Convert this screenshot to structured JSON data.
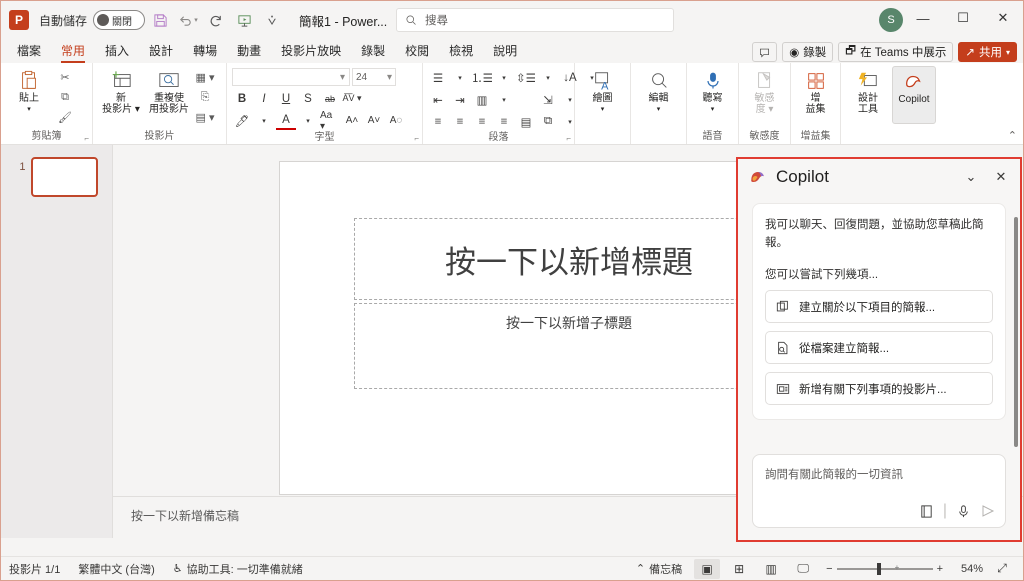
{
  "titlebar": {
    "app_logo": "powerpoint-logo",
    "autosave_label": "自動儲存",
    "autosave_state": "關閉",
    "document_title": "簡報1 - Power...",
    "search_placeholder": "搜尋",
    "avatar_initial": "S",
    "quick_access": [
      "save-icon",
      "undo-icon",
      "redo-icon",
      "start-slideshow-icon",
      "customize-qat-icon"
    ],
    "window_buttons": [
      "minimize",
      "maximize",
      "close"
    ]
  },
  "ribbon_tabs": {
    "items": [
      "檔案",
      "常用",
      "插入",
      "設計",
      "轉場",
      "動畫",
      "投影片放映",
      "錄製",
      "校閱",
      "檢視",
      "說明"
    ],
    "active": "常用",
    "right_actions": {
      "comments": "",
      "record": "錄製",
      "present_in_teams": "在 Teams 中展示",
      "share": "共用"
    }
  },
  "ribbon": {
    "groups": [
      {
        "label": "剪貼簿",
        "big": [
          {
            "label": "貼上",
            "icon": "paste-icon"
          }
        ],
        "small": [
          {
            "label": "",
            "icon": "cut-icon"
          },
          {
            "label": "",
            "icon": "copy-icon"
          },
          {
            "label": "",
            "icon": "format-painter-icon"
          }
        ]
      },
      {
        "label": "投影片",
        "big": [
          {
            "label": "新\n投影片",
            "icon": "new-slide-icon"
          },
          {
            "label": "重複使\n用投影片",
            "icon": "reuse-slides-icon"
          }
        ],
        "small": [
          {
            "label": "",
            "icon": "layout-icon"
          },
          {
            "label": "",
            "icon": "reset-icon"
          },
          {
            "label": "",
            "icon": "section-icon"
          }
        ]
      },
      {
        "label": "字型",
        "font_name": "",
        "font_size": "24",
        "row1": [
          "B",
          "I",
          "U",
          "S",
          "ab",
          "AV"
        ],
        "row2": [
          "text-highlight-icon",
          "font-color-icon",
          "Aa",
          "A^",
          "Av",
          "clear-format-icon"
        ]
      },
      {
        "label": "段落",
        "row1": [
          "bullets-icon",
          "numbering-icon",
          "line-spacing-icon",
          "text-direction-icon"
        ],
        "row2": [
          "decrease-indent-icon",
          "increase-indent-icon",
          "columns-icon",
          "align-text-icon"
        ],
        "row3": [
          "align-left-icon",
          "align-center-icon",
          "align-right-icon",
          "justify-icon",
          "smartart-icon",
          "convert-icon"
        ]
      },
      {
        "label": "",
        "big": [
          {
            "label": "繪圖",
            "icon": "draw-icon"
          }
        ]
      },
      {
        "label": "",
        "big": [
          {
            "label": "編輯",
            "icon": "edit-find-icon"
          }
        ]
      },
      {
        "label": "語音",
        "big": [
          {
            "label": "聽寫",
            "icon": "dictate-microphone-icon"
          }
        ]
      },
      {
        "label": "敏感度",
        "big": [
          {
            "label": "敏感\n度",
            "icon": "sensitivity-icon"
          }
        ]
      },
      {
        "label": "增益集",
        "big": [
          {
            "label": "增\n益集",
            "icon": "add-ins-icon"
          }
        ]
      },
      {
        "label": "",
        "big": [
          {
            "label": "設計\n工具",
            "icon": "designer-icon"
          },
          {
            "label": "Copilot",
            "icon": "copilot-icon"
          }
        ]
      }
    ]
  },
  "thumbnails": [
    {
      "number": "1"
    }
  ],
  "slide": {
    "title_placeholder": "按一下以新增標題",
    "subtitle_placeholder": "按一下以新增子標題",
    "notes_placeholder": "按一下以新增備忘稿"
  },
  "copilot": {
    "title": "Copilot",
    "icon": "copilot-icon",
    "collapse_icon": "chevron-down-icon",
    "close_icon": "close-icon",
    "greeting": "我可以聊天、回復問題，並協助您草稿此簡報。",
    "suggestions_label": "您可以嘗試下列幾項...",
    "suggestions": [
      {
        "text": "建立關於以下項目的簡報...",
        "icon": "copy-slides-icon"
      },
      {
        "text": "從檔案建立簡報...",
        "icon": "file-search-icon"
      },
      {
        "text": "新增有關下列事項的投影片...",
        "icon": "add-slide-icon"
      }
    ],
    "input_placeholder": "詢問有關此簡報的一切資訊",
    "input_icons": [
      "prompt-book-icon",
      "microphone-icon",
      "send-icon"
    ],
    "border_color": "#e03c31"
  },
  "statusbar": {
    "slide_count": "投影片 1/1",
    "language": "繁體中文 (台灣)",
    "accessibility": "協助工具: 一切準備就緒",
    "notes_button": "備忘稿",
    "views": [
      "normal-view-icon",
      "slide-sorter-icon",
      "reading-view-icon",
      "slideshow-icon"
    ],
    "zoom_value": "54%",
    "zoom_out": "−",
    "zoom_in": "+",
    "fit_icon": "fit-to-window-icon"
  },
  "colors": {
    "accent": "#c43e1c",
    "copilot_border": "#e03c31",
    "avatar": "#58866b"
  }
}
